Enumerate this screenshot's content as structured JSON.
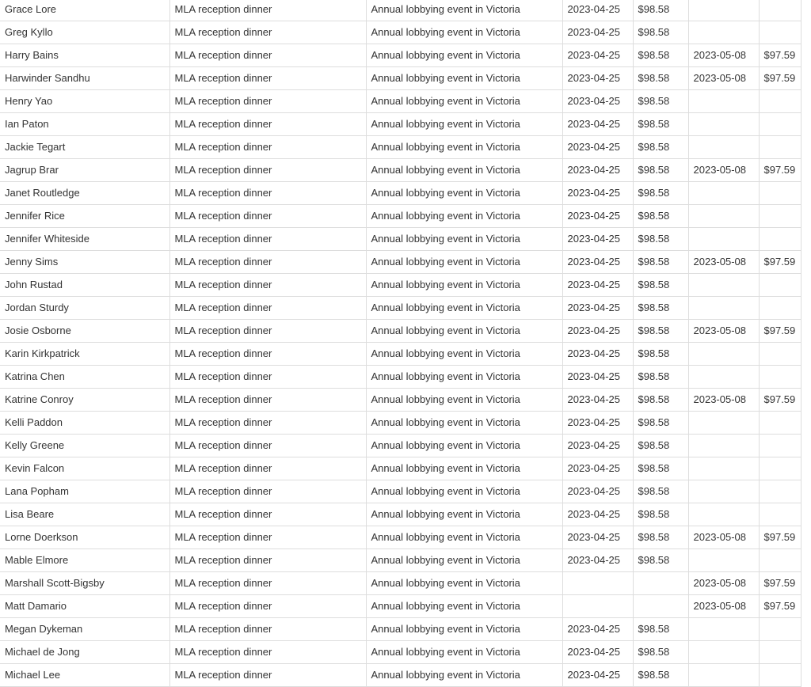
{
  "rows": [
    [
      "Grace Lore",
      "MLA reception dinner",
      "Annual lobbying event in Victoria",
      "2023-04-25",
      "$98.58",
      "",
      ""
    ],
    [
      "Greg Kyllo",
      "MLA reception dinner",
      "Annual lobbying event in Victoria",
      "2023-04-25",
      "$98.58",
      "",
      ""
    ],
    [
      "Harry Bains",
      "MLA reception dinner",
      "Annual lobbying event in Victoria",
      "2023-04-25",
      "$98.58",
      "2023-05-08",
      "$97.59"
    ],
    [
      "Harwinder Sandhu",
      "MLA reception dinner",
      "Annual lobbying event in Victoria",
      "2023-04-25",
      "$98.58",
      "2023-05-08",
      "$97.59"
    ],
    [
      "Henry Yao",
      "MLA reception dinner",
      "Annual lobbying event in Victoria",
      "2023-04-25",
      "$98.58",
      "",
      ""
    ],
    [
      "Ian Paton",
      "MLA reception dinner",
      "Annual lobbying event in Victoria",
      "2023-04-25",
      "$98.58",
      "",
      ""
    ],
    [
      "Jackie Tegart",
      "MLA reception dinner",
      "Annual lobbying event in Victoria",
      "2023-04-25",
      "$98.58",
      "",
      ""
    ],
    [
      "Jagrup Brar",
      "MLA reception dinner",
      "Annual lobbying event in Victoria",
      "2023-04-25",
      "$98.58",
      "2023-05-08",
      "$97.59"
    ],
    [
      "Janet Routledge",
      "MLA reception dinner",
      "Annual lobbying event in Victoria",
      "2023-04-25",
      "$98.58",
      "",
      ""
    ],
    [
      "Jennifer Rice",
      "MLA reception dinner",
      "Annual lobbying event in Victoria",
      "2023-04-25",
      "$98.58",
      "",
      ""
    ],
    [
      "Jennifer Whiteside",
      "MLA reception dinner",
      "Annual lobbying event in Victoria",
      "2023-04-25",
      "$98.58",
      "",
      ""
    ],
    [
      "Jenny Sims",
      "MLA reception dinner",
      "Annual lobbying event in Victoria",
      "2023-04-25",
      "$98.58",
      "2023-05-08",
      "$97.59"
    ],
    [
      "John Rustad",
      "MLA reception dinner",
      "Annual lobbying event in Victoria",
      "2023-04-25",
      "$98.58",
      "",
      ""
    ],
    [
      "Jordan Sturdy",
      "MLA reception dinner",
      "Annual lobbying event in Victoria",
      "2023-04-25",
      "$98.58",
      "",
      ""
    ],
    [
      "Josie Osborne",
      "MLA reception dinner",
      "Annual lobbying event in Victoria",
      "2023-04-25",
      "$98.58",
      "2023-05-08",
      "$97.59"
    ],
    [
      "Karin Kirkpatrick",
      "MLA reception dinner",
      "Annual lobbying event in Victoria",
      "2023-04-25",
      "$98.58",
      "",
      ""
    ],
    [
      "Katrina Chen",
      "MLA reception dinner",
      "Annual lobbying event in Victoria",
      "2023-04-25",
      "$98.58",
      "",
      ""
    ],
    [
      "Katrine Conroy",
      "MLA reception dinner",
      "Annual lobbying event in Victoria",
      "2023-04-25",
      "$98.58",
      "2023-05-08",
      "$97.59"
    ],
    [
      "Kelli Paddon",
      "MLA reception dinner",
      "Annual lobbying event in Victoria",
      "2023-04-25",
      "$98.58",
      "",
      ""
    ],
    [
      "Kelly Greene",
      "MLA reception dinner",
      "Annual lobbying event in Victoria",
      "2023-04-25",
      "$98.58",
      "",
      ""
    ],
    [
      "Kevin Falcon",
      "MLA reception dinner",
      "Annual lobbying event in Victoria",
      "2023-04-25",
      "$98.58",
      "",
      ""
    ],
    [
      "Lana Popham",
      "MLA reception dinner",
      "Annual lobbying event in Victoria",
      "2023-04-25",
      "$98.58",
      "",
      ""
    ],
    [
      "Lisa Beare",
      "MLA reception dinner",
      "Annual lobbying event in Victoria",
      "2023-04-25",
      "$98.58",
      "",
      ""
    ],
    [
      "Lorne Doerkson",
      "MLA reception dinner",
      "Annual lobbying event in Victoria",
      "2023-04-25",
      "$98.58",
      "2023-05-08",
      "$97.59"
    ],
    [
      "Mable Elmore",
      "MLA reception dinner",
      "Annual lobbying event in Victoria",
      "2023-04-25",
      "$98.58",
      "",
      ""
    ],
    [
      "Marshall Scott-Bigsby",
      "MLA reception dinner",
      "Annual lobbying event in Victoria",
      "",
      "",
      "2023-05-08",
      "$97.59"
    ],
    [
      "Matt Damario",
      "MLA reception dinner",
      "Annual lobbying event in Victoria",
      "",
      "",
      "2023-05-08",
      "$97.59"
    ],
    [
      "Megan Dykeman",
      "MLA reception dinner",
      "Annual lobbying event in Victoria",
      "2023-04-25",
      "$98.58",
      "",
      ""
    ],
    [
      "Michael de Jong",
      "MLA reception dinner",
      "Annual lobbying event in Victoria",
      "2023-04-25",
      "$98.58",
      "",
      ""
    ],
    [
      "Michael Lee",
      "MLA reception dinner",
      "Annual lobbying event in Victoria",
      "2023-04-25",
      "$98.58",
      "",
      ""
    ]
  ]
}
